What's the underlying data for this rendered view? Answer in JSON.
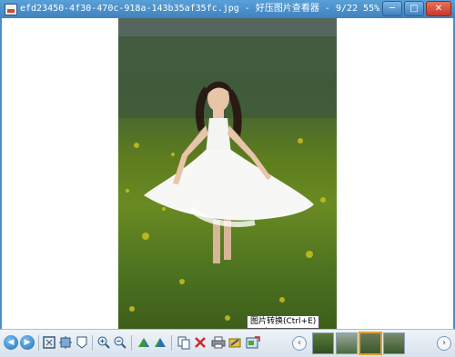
{
  "window": {
    "title": "efd23450-4f30-470c-918a-143b35af35fc.jpg - 好压图片查看器 - 9/22 55%",
    "minimize_label": "─",
    "maximize_label": "□",
    "close_label": "✕"
  },
  "toolbar": {
    "prev_label": "◀",
    "next_label": "▶",
    "tooltip": "图片转换(Ctrl+E)",
    "thumb_prev_label": "‹",
    "thumb_next_label": "›"
  },
  "colors": {
    "title_bar": "#4a8fc8",
    "toolbar_bg": "#e6edf4",
    "close_button": "#c4382a",
    "active_thumb_border": "#e0a030"
  }
}
